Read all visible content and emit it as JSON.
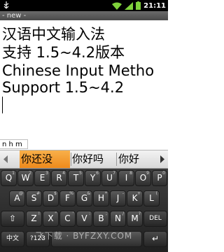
{
  "status_bar": {
    "time": "21:11",
    "icons": [
      "usb-icon",
      "wifi-icon",
      "signal-icon",
      "battery-icon"
    ]
  },
  "app": {
    "title": "- new -"
  },
  "editor": {
    "lines": [
      "汉语中文输入法",
      "支持 1.5~4.2版本",
      "Chinese Input Metho",
      "Support 1.5~4.2"
    ]
  },
  "composing": {
    "text": "n h m"
  },
  "candidates": {
    "items": [
      "你还没",
      "你好吗",
      "你好"
    ],
    "selected_index": 0,
    "left_arrow_icon": "triangle-left-icon",
    "right_arrow_icon": "triangle-right-icon"
  },
  "keyboard": {
    "row1": [
      {
        "key": "Q",
        "sub": "1"
      },
      {
        "key": "W",
        "sub": "2"
      },
      {
        "key": "E",
        "sub": "3"
      },
      {
        "key": "R",
        "sub": "4"
      },
      {
        "key": "T",
        "sub": "5"
      },
      {
        "key": "Y",
        "sub": "6"
      },
      {
        "key": "U",
        "sub": "7"
      },
      {
        "key": "I",
        "sub": "8"
      },
      {
        "key": "O",
        "sub": "9"
      },
      {
        "key": "P",
        "sub": "0"
      }
    ],
    "row2": [
      {
        "key": "A",
        "sub": "@"
      },
      {
        "key": "S",
        "sub": "#"
      },
      {
        "key": "D",
        "sub": "$"
      },
      {
        "key": "F",
        "sub": "%"
      },
      {
        "key": "G",
        "sub": "&"
      },
      {
        "key": "H",
        "sub": "*"
      },
      {
        "key": "J",
        "sub": "-"
      },
      {
        "key": "K",
        "sub": "+"
      },
      {
        "key": "L",
        "sub": "("
      }
    ],
    "row3": [
      {
        "key": "Z",
        "sub": "!"
      },
      {
        "key": "X",
        "sub": "\""
      },
      {
        "key": "C",
        "sub": "'"
      },
      {
        "key": "V",
        "sub": ":"
      },
      {
        "key": "B",
        "sub": ";"
      },
      {
        "key": "N",
        "sub": "/"
      },
      {
        "key": "M",
        "sub": "?"
      }
    ],
    "shift_label": "⇧",
    "delete_label": "DEL",
    "lang_label": "中文",
    "symbols_label": "?123",
    "space_label": "",
    "enter_label": "↵"
  },
  "watermark": "飞下载 · BYFZXY.COM"
}
